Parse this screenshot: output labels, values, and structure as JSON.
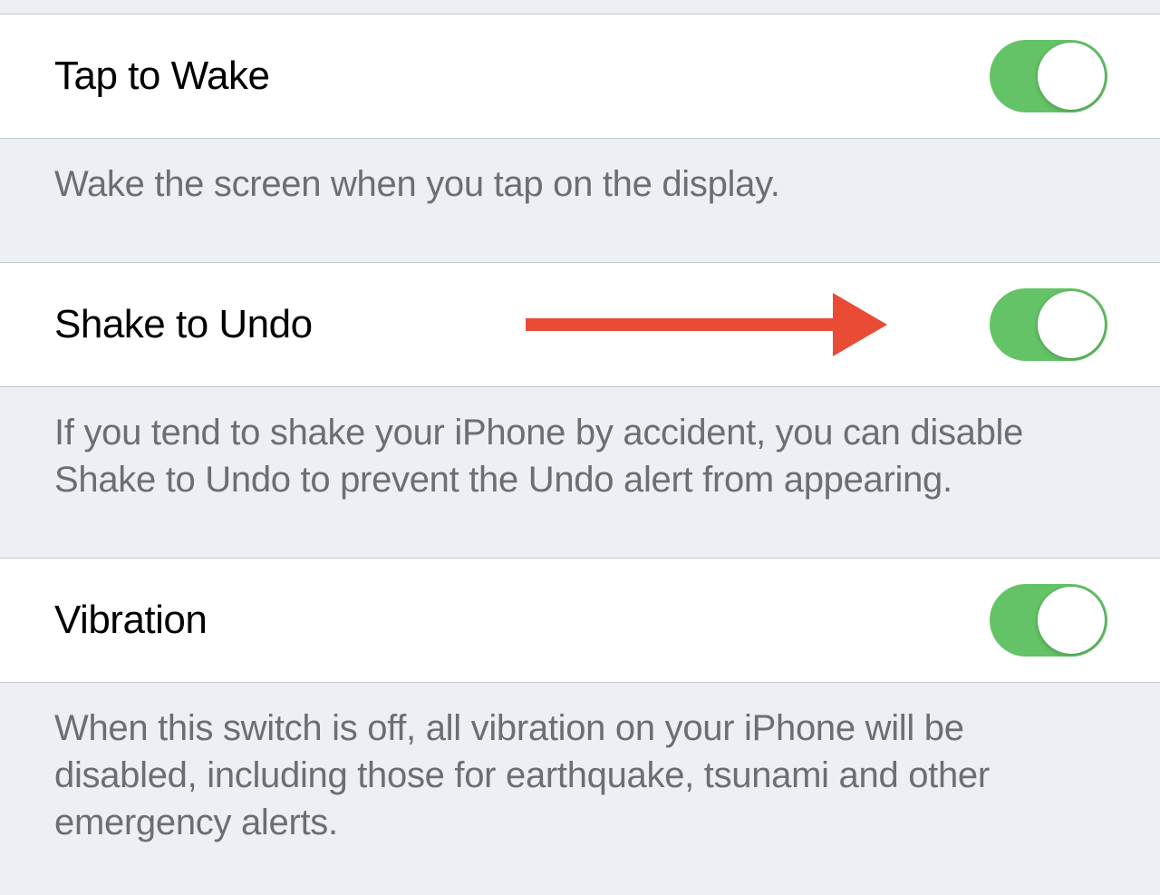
{
  "settings": [
    {
      "label": "Tap to Wake",
      "description": "Wake the screen when you tap on the display.",
      "enabled": true,
      "annotated": false
    },
    {
      "label": "Shake to Undo",
      "description": "If you tend to shake your iPhone by accident, you can disable Shake to Undo to prevent the Undo alert from appearing.",
      "enabled": true,
      "annotated": true
    },
    {
      "label": "Vibration",
      "description": "When this switch is off, all vibration on your iPhone will be disabled, including those for earthquake, tsunami and other emergency alerts.",
      "enabled": true,
      "annotated": false
    }
  ],
  "colors": {
    "toggle_on": "#64c366",
    "annotation_arrow": "#e94b35"
  }
}
